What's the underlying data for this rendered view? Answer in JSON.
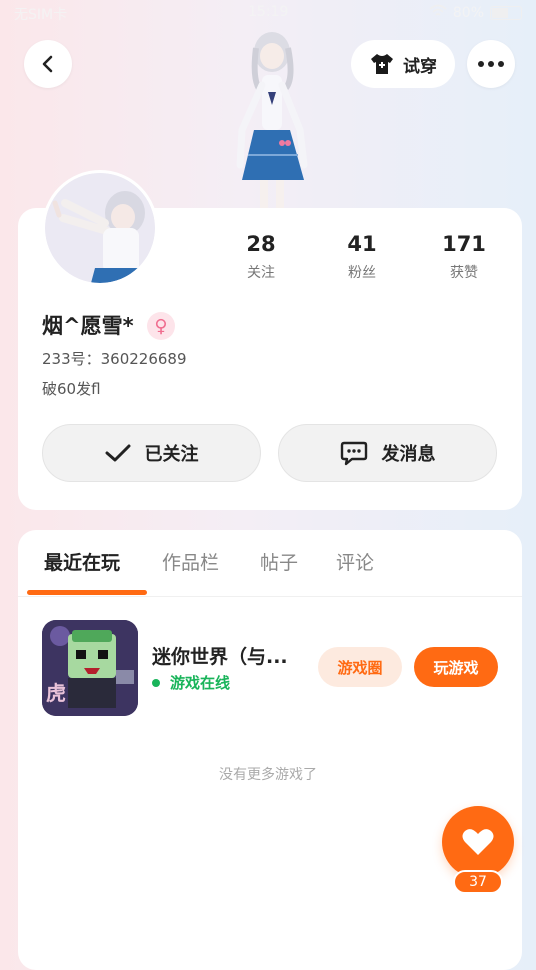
{
  "status_bar": {
    "left": "无SIM卡",
    "time": "15:19",
    "battery": "80%"
  },
  "header": {
    "try_label": "试穿"
  },
  "profile": {
    "stats": [
      {
        "value": "28",
        "label": "关注"
      },
      {
        "value": "41",
        "label": "粉丝"
      },
      {
        "value": "171",
        "label": "获赞"
      }
    ],
    "username": "烟^愿雪*",
    "gender_symbol": "♀",
    "uid": "233号：360226689",
    "bio": "破60发fl",
    "follow_label": "已关注",
    "message_label": "发消息"
  },
  "tabs": [
    {
      "label": "最近在玩"
    },
    {
      "label": "作品栏"
    },
    {
      "label": "帖子"
    },
    {
      "label": "评论"
    }
  ],
  "games": [
    {
      "title": "迷你世界（与...",
      "status": "游戏在线",
      "circle_label": "游戏圈",
      "play_label": "玩游戏"
    }
  ],
  "no_more_text": "没有更多游戏了",
  "like": {
    "count": "37"
  },
  "colors": {
    "accent": "#ff6a13",
    "online": "#19b45a",
    "gender": "#f06d8f"
  }
}
